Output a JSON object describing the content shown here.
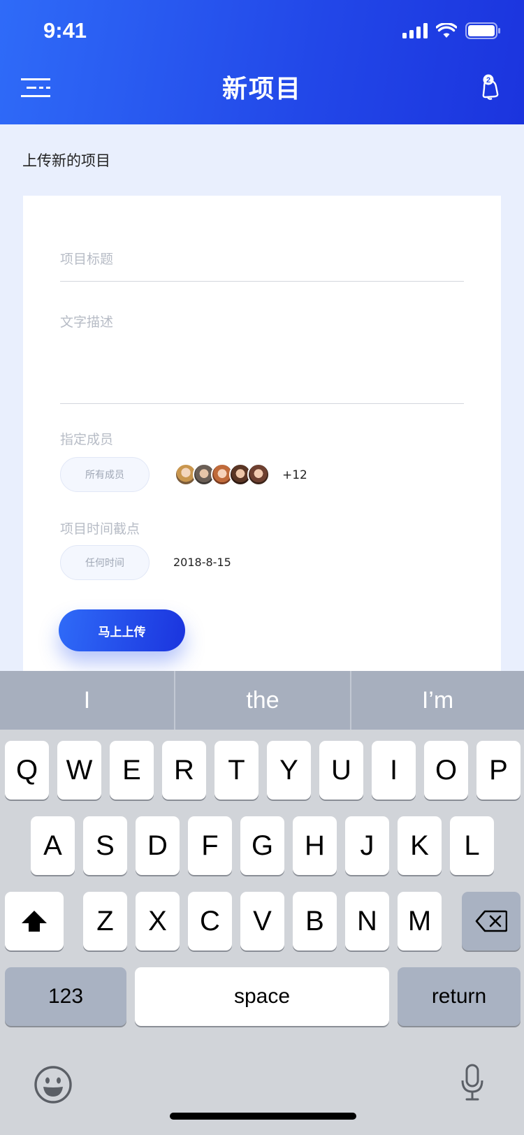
{
  "status_bar": {
    "time": "9:41"
  },
  "header": {
    "title": "新项目",
    "notification_count": "2"
  },
  "section_title": "上传新的项目",
  "form": {
    "title_placeholder": "项目标题",
    "description_placeholder": "文字描述",
    "members_label": "指定成员",
    "members_button": "所有成员",
    "members_more": "+12",
    "deadline_label": "项目时间截点",
    "deadline_button": "任何时间",
    "deadline_value": "2018-8-15",
    "submit_label": "马上上传"
  },
  "keyboard": {
    "suggestions": [
      "I",
      "the",
      "I’m"
    ],
    "row1": [
      "Q",
      "W",
      "E",
      "R",
      "T",
      "Y",
      "U",
      "I",
      "O",
      "P"
    ],
    "row2": [
      "A",
      "S",
      "D",
      "F",
      "G",
      "H",
      "J",
      "K",
      "L"
    ],
    "row3": [
      "Z",
      "X",
      "C",
      "V",
      "B",
      "N",
      "M"
    ],
    "numbers_label": "123",
    "space_label": "space",
    "return_label": "return"
  },
  "colors": {
    "accent": "#2F6BF8",
    "accent_dark": "#1B34DE",
    "background": "#E9EFFD"
  }
}
